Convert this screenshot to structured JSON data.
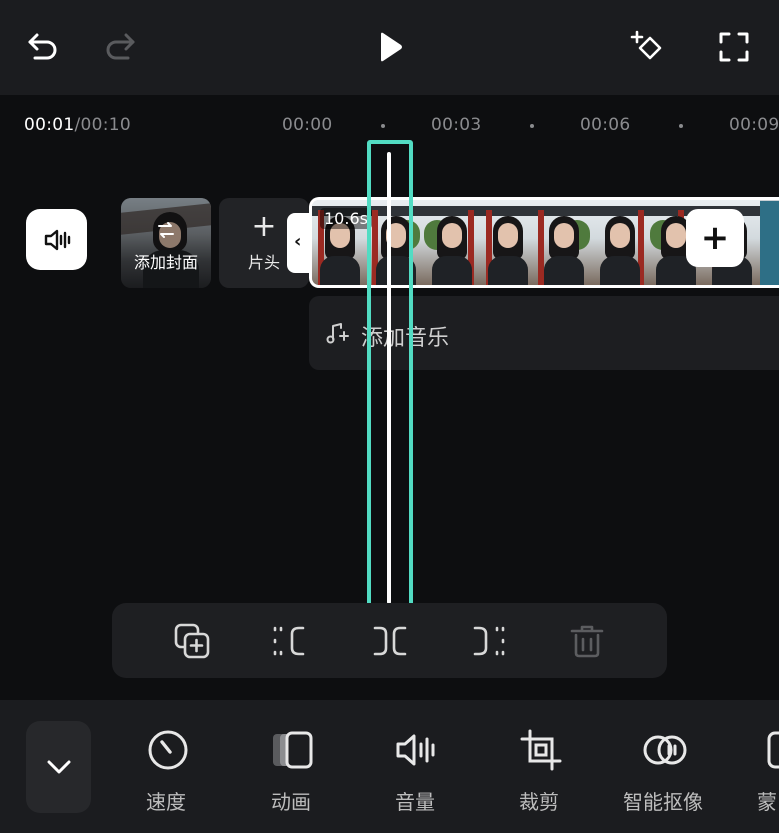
{
  "toolbar": {
    "undo_icon": "undo-icon",
    "redo_icon": "redo-icon",
    "play_icon": "play-icon",
    "keyframe_icon": "add-keyframe-icon",
    "fullscreen_icon": "fullscreen-icon"
  },
  "timeline": {
    "current_time": "00:01",
    "total_time": "/00:10",
    "ticks": [
      "00:00",
      "00:03",
      "00:06",
      "00:09"
    ]
  },
  "tracks": {
    "audio_toggle_icon": "speaker-icon",
    "cover_label": "添加封面",
    "intro_plus": "+",
    "intro_label": "片头",
    "clip_duration": "10.6s",
    "add_clip": "+",
    "music_label": "添加音乐"
  },
  "edit_tools": [
    {
      "name": "copy-icon"
    },
    {
      "name": "split-left-icon"
    },
    {
      "name": "split-icon"
    },
    {
      "name": "split-right-icon"
    },
    {
      "name": "delete-icon"
    }
  ],
  "bottom_tabs": {
    "speed": "速度",
    "animation": "动画",
    "volume": "音量",
    "crop": "裁剪",
    "smart_cutout": "智能抠像",
    "mask_partial": "蒙"
  },
  "colors": {
    "accent": "#52dcc3",
    "background": "#0d0e10",
    "panel": "#1b1c1f"
  }
}
